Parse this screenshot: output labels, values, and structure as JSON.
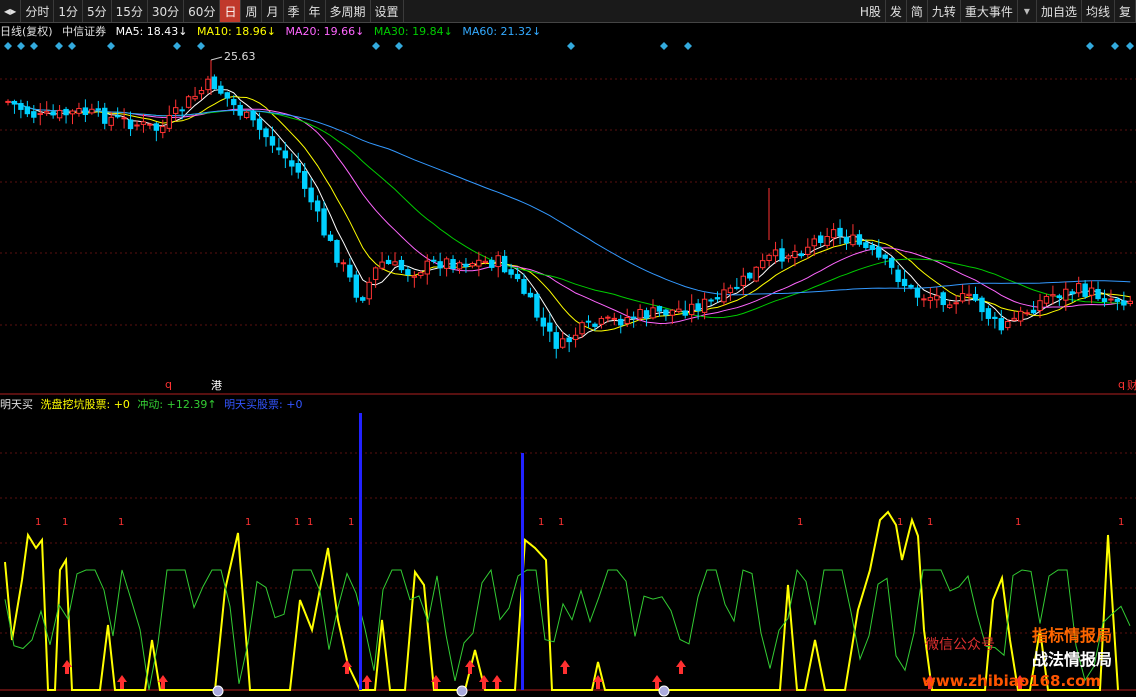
{
  "toolbar": {
    "left_items": [
      "分时",
      "1分",
      "5分",
      "15分",
      "30分",
      "60分",
      "日",
      "周",
      "月",
      "季",
      "年",
      "多周期",
      "设置"
    ],
    "active_index": 6,
    "right_items": [
      "H股",
      "发",
      "简",
      "九转",
      "重大事件",
      "加自选",
      "均线",
      "复"
    ]
  },
  "info": {
    "period": "日线(复权)",
    "stock": "中信证券",
    "ma5": "MA5: 18.43↓",
    "ma10": "MA10: 18.96↓",
    "ma20": "MA20: 19.66↓",
    "ma30": "MA30: 19.84↓",
    "ma60": "MA60: 21.32↓",
    "high_label": "25.63",
    "mark_q_left": "q",
    "mark_gang": "港",
    "mark_q_right": "q",
    "mark_cai": "财"
  },
  "indicator": {
    "name": "明天买",
    "f1": "洗盘挖坑股票: +0",
    "f2": "冲动: +12.39↑",
    "f3": "明天买股票: +0",
    "one_label": "1"
  },
  "colors": {
    "up": "#ff3232",
    "down": "#00d0ff",
    "ma5": "#ffffff",
    "ma10": "#ffff00",
    "ma20": "#ff66ff",
    "ma30": "#00cc00",
    "ma60": "#3399ff",
    "osc_yellow": "#ffff00",
    "osc_green": "#33cc33",
    "signal_blue": "#2222ff"
  },
  "watermark": {
    "wechat": "微信公众号",
    "line1": "指标情报局",
    "line2": "战法情报局",
    "url": "www.zhibiao168.com"
  }
}
